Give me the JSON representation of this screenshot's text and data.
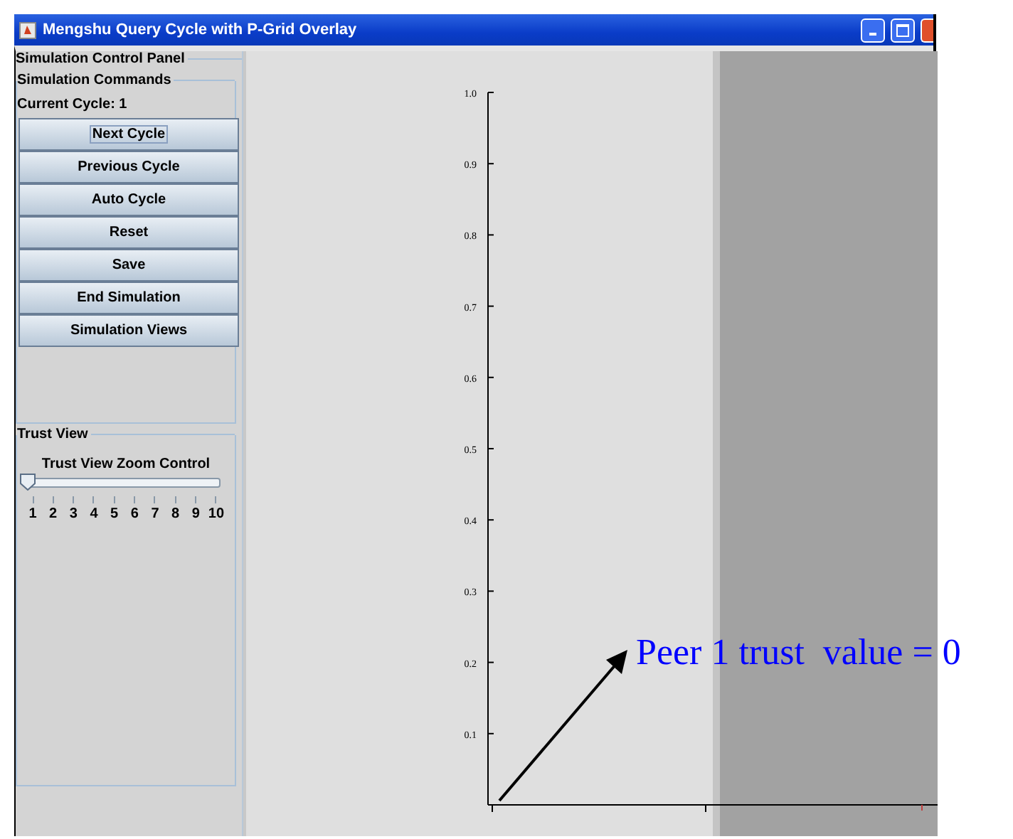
{
  "window": {
    "title": "Mengshu Query Cycle with P-Grid Overlay"
  },
  "control_panel": {
    "title": "Simulation Control Panel",
    "commands": {
      "title": "Simulation Commands",
      "current_cycle": "Current Cycle: 1",
      "buttons": [
        {
          "label": "Next Cycle",
          "focused": true
        },
        {
          "label": "Previous Cycle",
          "focused": false
        },
        {
          "label": "Auto Cycle",
          "focused": false
        },
        {
          "label": "Reset",
          "focused": false
        },
        {
          "label": "Save",
          "focused": false
        },
        {
          "label": "End Simulation",
          "focused": false
        },
        {
          "label": "Simulation Views",
          "focused": false
        }
      ]
    },
    "trust_view": {
      "title": "Trust View",
      "slider": {
        "label": "Trust View Zoom Control",
        "level": 0,
        "tick_labels": [
          "1",
          "2",
          "3",
          "4",
          "5",
          "6",
          "7",
          "8",
          "9",
          "10"
        ]
      }
    }
  },
  "plot": {
    "y_tick_labels": [
      "1.0",
      "0.9",
      "0.8",
      "0.7",
      "0.6",
      "0.5",
      "0.4",
      "0.3",
      "0.2",
      "0.1"
    ]
  },
  "annotation": {
    "text": "Peer 1 trust  value = 0"
  }
}
